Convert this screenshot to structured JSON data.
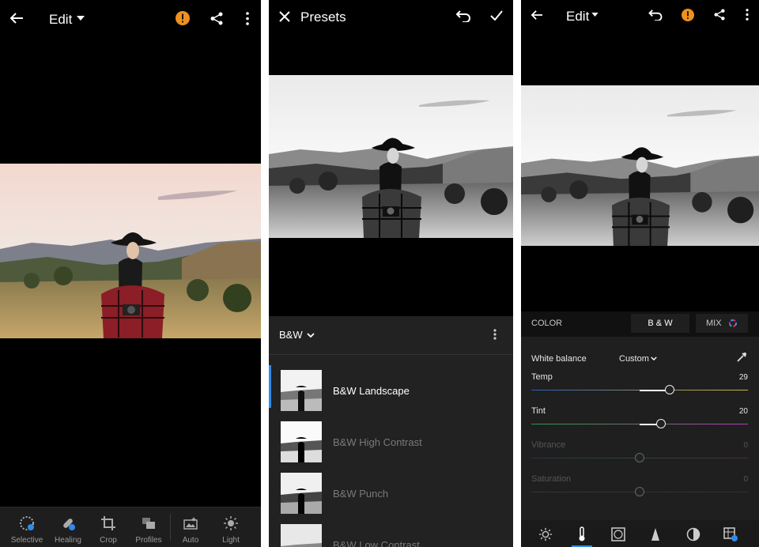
{
  "panel1": {
    "title": "Edit",
    "tools": [
      {
        "label": "Selective",
        "icon": "selective-icon"
      },
      {
        "label": "Healing",
        "icon": "healing-icon"
      },
      {
        "label": "Crop",
        "icon": "crop-icon"
      },
      {
        "label": "Profiles",
        "icon": "profiles-icon"
      },
      {
        "label": "Auto",
        "icon": "auto-icon"
      },
      {
        "label": "Light",
        "icon": "light-icon"
      }
    ]
  },
  "panel2": {
    "title": "Presets",
    "group": "B&W",
    "presets": [
      {
        "name": "B&W Landscape",
        "selected": true
      },
      {
        "name": "B&W High Contrast",
        "selected": false
      },
      {
        "name": "B&W Punch",
        "selected": false
      },
      {
        "name": "B&W Low Contrast",
        "selected": false
      }
    ]
  },
  "panel3": {
    "title": "Edit",
    "tabs": {
      "color": "COLOR",
      "bw": "B & W",
      "mix": "MIX"
    },
    "white_balance": {
      "label": "White balance",
      "value": "Custom"
    },
    "sliders": [
      {
        "label": "Temp",
        "value": "29",
        "level": 0.64,
        "enabled": true
      },
      {
        "label": "Tint",
        "value": "20",
        "level": 0.6,
        "enabled": true
      },
      {
        "label": "Vibrance",
        "value": "0",
        "level": 0.5,
        "enabled": false
      },
      {
        "label": "Saturation",
        "value": "0",
        "level": 0.5,
        "enabled": false
      }
    ]
  },
  "colors": {
    "accent_orange": "#f0901e",
    "selection_blue": "#2d8ceb"
  }
}
